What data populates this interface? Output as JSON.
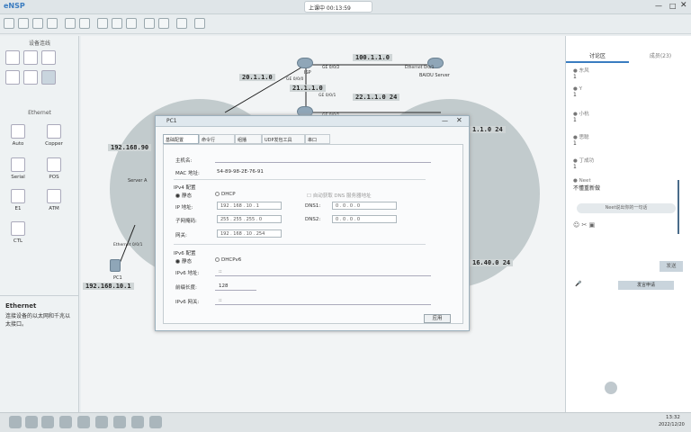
{
  "app": {
    "title": "eNSP",
    "recording": "上课中 00:13:59"
  },
  "left": {
    "section1": "设备连线",
    "section2": "Ethernet",
    "devices": [
      "Auto",
      "Copper",
      "Serial",
      "POS",
      "E1",
      "ATM",
      "CTL"
    ],
    "info_title": "Ethernet",
    "info_text": "连接设备的以太网和千兆以太接口。"
  },
  "canvas": {
    "labels": [
      "100.1.1.0",
      "20.1.1.0",
      "21.1.1.0",
      "22.1.1.0 24",
      "192.168.90",
      "1.1.0 24",
      "16.40.0 24",
      "192.168.10.1"
    ],
    "node_labels": [
      "ISP",
      "BAIDU Server",
      "Ethernet 0/0/1",
      "GE 0/0/0",
      "GE 0/0/2",
      "GE 0/0/1",
      "Server A",
      "PC1",
      "GE 0/0/1",
      "Ethernet 0/0/1"
    ]
  },
  "dialog": {
    "title": "PC1",
    "tabs": [
      "基础配置",
      "命令行",
      "组播",
      "UDP发包工具",
      "串口"
    ],
    "host_label": "主机名:",
    "mac_label": "MAC 地址:",
    "mac": "54-89-98-2E-76-91",
    "ipv4_title": "IPv4 配置",
    "static": "静态",
    "dhcp": "DHCP",
    "auto_dns": "自动获取 DNS 服务器地址",
    "ip_label": "IP 地址:",
    "ip": "192 . 168 . 10 . 1",
    "mask_label": "子网掩码:",
    "mask": "255 . 255 . 255 . 0",
    "gw_label": "网关:",
    "gw": "192 . 168 . 10 . 254",
    "dns1_label": "DNS1:",
    "dns1": "0 . 0 . 0 . 0",
    "dns2_label": "DNS2:",
    "dns2": "0 . 0 . 0 . 0",
    "ipv6_title": "IPv6 配置",
    "dhcpv6": "DHCPv6",
    "ipv6_label": "IPv6 地址:",
    "ipv6": "::",
    "prefix_label": "前缀长度:",
    "prefix": "128",
    "gw6_label": "IPv6 网关:",
    "gw6": "::",
    "apply": "应用"
  },
  "chat": {
    "tab1": "讨论区",
    "tab2": "成员(23)",
    "msgs": [
      {
        "name": "东风",
        "text": "1"
      },
      {
        "name": "Y",
        "text": "1"
      },
      {
        "name": "小杭",
        "text": "1"
      },
      {
        "name": "思聪",
        "text": "1"
      },
      {
        "name": "丁成功",
        "text": "1"
      },
      {
        "name": "Neet",
        "text": "不懂重新做"
      }
    ],
    "input_hint": "Neet说出你的一句话",
    "send": "发送",
    "mic": "发言申请"
  },
  "taskbar": {
    "time": "13:32",
    "date": "2022/12/20"
  }
}
